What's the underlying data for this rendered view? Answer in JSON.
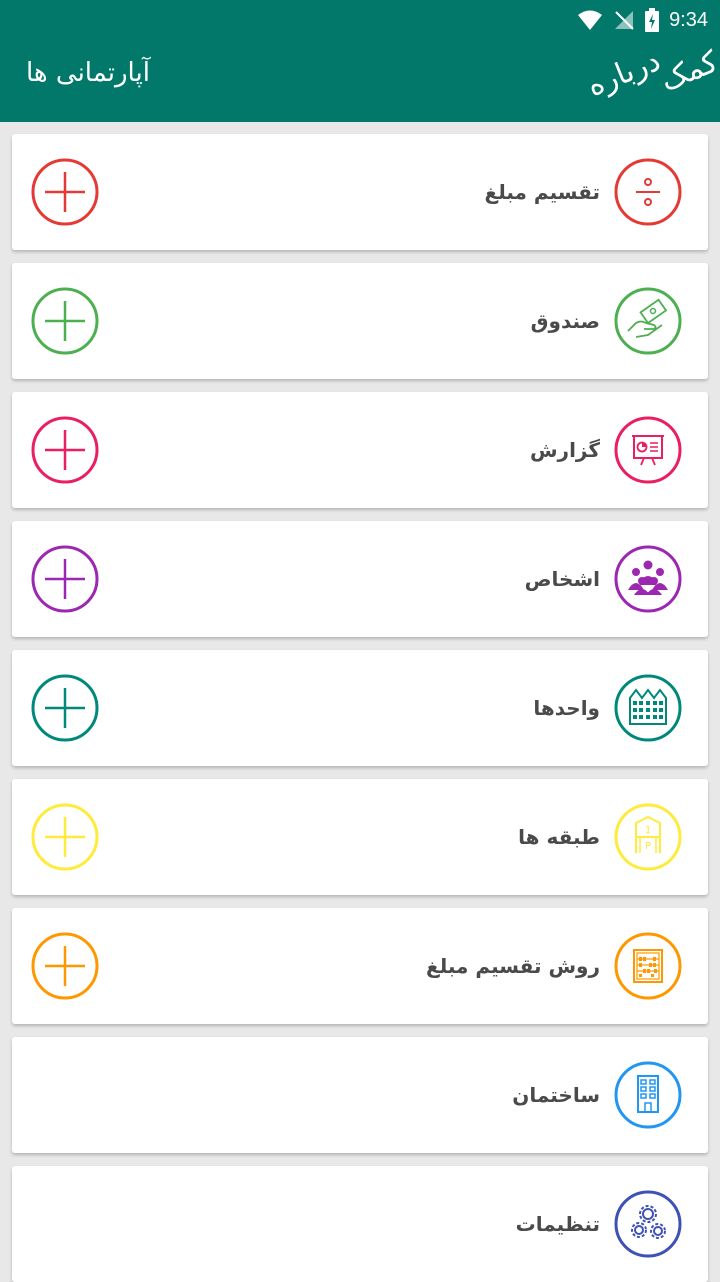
{
  "status": {
    "time": "9:34"
  },
  "appbar": {
    "title": "آپارتمانی ها",
    "about": "درباره",
    "help": "کمک"
  },
  "colors": {
    "primary": "#02786b",
    "red": "#e53935",
    "green": "#4caf50",
    "pink": "#e91e63",
    "purple": "#9c27b0",
    "teal": "#00897b",
    "yellow": "#ffeb3b",
    "orange": "#ff9800",
    "blue": "#2196f3",
    "indigo": "#3f51b5"
  },
  "items": [
    {
      "label": "تقسیم مبلغ",
      "icon": "divide-icon",
      "color": "#e53935",
      "has_add": true
    },
    {
      "label": "صندوق",
      "icon": "money-hand-icon",
      "color": "#4caf50",
      "has_add": true
    },
    {
      "label": "گزارش",
      "icon": "presentation-chart-icon",
      "color": "#e91e63",
      "has_add": true
    },
    {
      "label": "اشخاص",
      "icon": "people-group-icon",
      "color": "#9c27b0",
      "has_add": true
    },
    {
      "label": "واحدها",
      "icon": "buildings-icon",
      "color": "#00897b",
      "has_add": true
    },
    {
      "label": "طبقه ها",
      "icon": "floors-icon",
      "color": "#ffeb3b",
      "has_add": true
    },
    {
      "label": "روش تقسیم مبلغ",
      "icon": "abacus-icon",
      "color": "#ff9800",
      "has_add": true
    },
    {
      "label": "ساختمان",
      "icon": "building-icon",
      "color": "#2196f3",
      "has_add": false
    },
    {
      "label": "تنظیمات",
      "icon": "gears-icon",
      "color": "#3f51b5",
      "has_add": false
    }
  ]
}
